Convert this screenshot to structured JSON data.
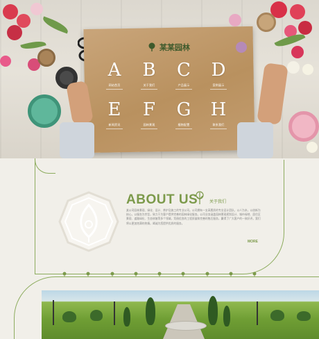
{
  "brand": {
    "name": "某某园林"
  },
  "hero": {
    "letters": [
      {
        "letter": "A",
        "label": "网站首页"
      },
      {
        "letter": "B",
        "label": "关于我们"
      },
      {
        "letter": "C",
        "label": "产品展示"
      },
      {
        "letter": "D",
        "label": "案例展示"
      },
      {
        "letter": "E",
        "label": "新闻资讯"
      },
      {
        "letter": "F",
        "label": "园林景观"
      },
      {
        "letter": "G",
        "label": "植物配置"
      },
      {
        "letter": "H",
        "label": "联系我们"
      }
    ]
  },
  "about": {
    "title": "ABOUT US",
    "subtitle": "关于我们",
    "text": "某公司园林景观、绿化、设计、养护及施工的专业公司。公司拥有一支高素质的专业设计团队，以人为本，以创新为核心，以服务为宗旨，致力于为客户提供完善的园林绿化服务。公司业务涵盖园林景观规划设计、城市绿地、居住区景观、道路绿化、生态修复等多个领域，凭借优良的工程质量和完善的售后服务，赢得了广大客户的一致好评。我们将以更加饱满的热情，竭诚为您提供优质的服务。",
    "more": "MORE"
  },
  "colors": {
    "accent": "#7c9a4b",
    "frame": "#8dac5e",
    "background": "#f1efe9"
  }
}
